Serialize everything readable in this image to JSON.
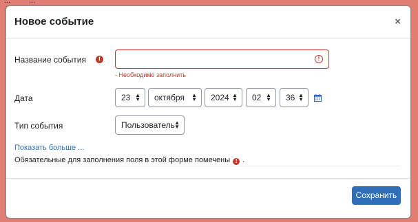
{
  "backdrop": {
    "text": "...",
    "link": "..."
  },
  "modal": {
    "title": "Новое событие",
    "close_label": "×"
  },
  "form": {
    "name": {
      "label": "Название события",
      "value": "",
      "error": "- Необходимо заполнить"
    },
    "date": {
      "label": "Дата",
      "day": "23",
      "month": "октября",
      "year": "2024",
      "hour": "02",
      "minute": "36"
    },
    "event_type": {
      "label": "Тип события",
      "value": "Пользователь"
    },
    "show_more": "Показать больше ...",
    "required_note_before": "Обязательные для заполнения поля в этой форме помечены",
    "required_note_after": "."
  },
  "footer": {
    "save_label": "Сохранить"
  },
  "colors": {
    "accent": "#2f6fb7",
    "error": "#c0392b",
    "backdrop": "#e07e74"
  },
  "icons": {
    "required": "exclamation-circle-icon",
    "input_error": "exclamation-circle-outline-icon",
    "calendar": "calendar-icon",
    "select_arrows": "sort-arrows-icon",
    "close": "close-icon"
  }
}
